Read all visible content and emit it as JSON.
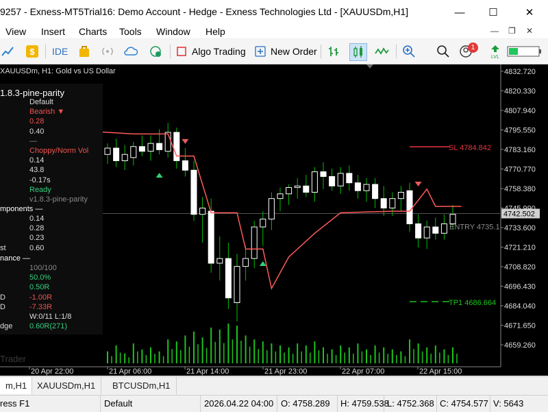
{
  "window": {
    "title": "9257 - Exness-MT5Trial16: Demo Account - Hedge - Exness Technologies Ltd - [XAUUSDm,H1]",
    "min_glyph": "—",
    "max_glyph": "☐",
    "close_glyph": "✕"
  },
  "menu": {
    "items": [
      "View",
      "Insert",
      "Charts",
      "Tools",
      "Window",
      "Help"
    ]
  },
  "toolbar": {
    "ide_label": "IDE",
    "algo_trading_label": "Algo Trading",
    "new_order_label": "New Order",
    "notification_count": "1",
    "icons": [
      "chart-icon",
      "dollar-icon",
      "ide-icon",
      "bag-icon",
      "signal-icon",
      "cloud-icon",
      "vps-icon",
      "algo-trading-icon",
      "new-order-icon",
      "bar-chart-icon",
      "candlestick-icon",
      "line-chart-icon",
      "zoom-in-icon",
      "search-icon",
      "user-icon",
      "level-icon",
      "battery-icon"
    ]
  },
  "chart": {
    "symbol_header": "XAUUSDm, H1:  Gold vs US Dollar",
    "watermark": "Trader",
    "colors": {
      "background": "#000000",
      "candle_up": "#ffffff",
      "candle_down": "#ffffff",
      "wick": "#00c000",
      "trail": "#ff5a5a",
      "sl": "#e8363f",
      "tp": "#1ec41e",
      "volume": "#1ec41e"
    },
    "price_axis": [
      "4832.720",
      "4820.330",
      "4807.940",
      "4795.550",
      "4783.160",
      "4770.770",
      "4758.380",
      "4745.990",
      "4733.600",
      "4721.210",
      "4708.820",
      "4696.430",
      "4684.040",
      "4671.650",
      "4659.260"
    ],
    "current_price_label": "4742.502",
    "sl_label": "SL 4784.842",
    "entry_label": "ENTRY 4735.1",
    "tp_label": "TP1 4686.664",
    "time_axis": [
      "20 Apr 22:00",
      "21 Apr 06:00",
      "21 Apr 14:00",
      "21 Apr 23:00",
      "22 Apr 07:00",
      "22 Apr 15:00"
    ]
  },
  "chart_data": {
    "type": "candlestick",
    "symbol": "XAUUSDm",
    "timeframe": "H1",
    "ylim": [
      4652,
      4838
    ],
    "candles": [
      {
        "o": 4780,
        "h": 4787,
        "l": 4774,
        "c": 4784
      },
      {
        "o": 4784,
        "h": 4790,
        "l": 4772,
        "c": 4776
      },
      {
        "o": 4776,
        "h": 4786,
        "l": 4770,
        "c": 4780
      },
      {
        "o": 4778,
        "h": 4788,
        "l": 4773,
        "c": 4785
      },
      {
        "o": 4785,
        "h": 4792,
        "l": 4779,
        "c": 4782
      },
      {
        "o": 4782,
        "h": 4792,
        "l": 4776,
        "c": 4787
      },
      {
        "o": 4787,
        "h": 4796,
        "l": 4780,
        "c": 4783
      },
      {
        "o": 4782,
        "h": 4800,
        "l": 4778,
        "c": 4794
      },
      {
        "o": 4794,
        "h": 4797,
        "l": 4771,
        "c": 4776
      },
      {
        "o": 4776,
        "h": 4784,
        "l": 4766,
        "c": 4770
      },
      {
        "o": 4770,
        "h": 4776,
        "l": 4738,
        "c": 4742
      },
      {
        "o": 4742,
        "h": 4753,
        "l": 4724,
        "c": 4746
      },
      {
        "o": 4744,
        "h": 4752,
        "l": 4705,
        "c": 4711
      },
      {
        "o": 4711,
        "h": 4728,
        "l": 4700,
        "c": 4714
      },
      {
        "o": 4714,
        "h": 4724,
        "l": 4682,
        "c": 4689
      },
      {
        "o": 4686,
        "h": 4717,
        "l": 4674,
        "c": 4709
      },
      {
        "o": 4709,
        "h": 4722,
        "l": 4700,
        "c": 4714
      },
      {
        "o": 4714,
        "h": 4738,
        "l": 4708,
        "c": 4734
      },
      {
        "o": 4734,
        "h": 4744,
        "l": 4722,
        "c": 4739
      },
      {
        "o": 4739,
        "h": 4756,
        "l": 4732,
        "c": 4752
      },
      {
        "o": 4752,
        "h": 4759,
        "l": 4744,
        "c": 4755
      },
      {
        "o": 4755,
        "h": 4761,
        "l": 4748,
        "c": 4759
      },
      {
        "o": 4759,
        "h": 4765,
        "l": 4752,
        "c": 4760
      },
      {
        "o": 4760,
        "h": 4767,
        "l": 4753,
        "c": 4756
      },
      {
        "o": 4756,
        "h": 4772,
        "l": 4750,
        "c": 4769
      },
      {
        "o": 4769,
        "h": 4775,
        "l": 4758,
        "c": 4766
      },
      {
        "o": 4766,
        "h": 4771,
        "l": 4757,
        "c": 4760
      },
      {
        "o": 4760,
        "h": 4772,
        "l": 4755,
        "c": 4768
      },
      {
        "o": 4768,
        "h": 4773,
        "l": 4757,
        "c": 4762
      },
      {
        "o": 4762,
        "h": 4767,
        "l": 4752,
        "c": 4757
      },
      {
        "o": 4757,
        "h": 4765,
        "l": 4750,
        "c": 4761
      },
      {
        "o": 4761,
        "h": 4765,
        "l": 4746,
        "c": 4752
      },
      {
        "o": 4752,
        "h": 4760,
        "l": 4741,
        "c": 4746
      },
      {
        "o": 4746,
        "h": 4756,
        "l": 4741,
        "c": 4752
      },
      {
        "o": 4752,
        "h": 4760,
        "l": 4744,
        "c": 4756
      },
      {
        "o": 4757,
        "h": 4762,
        "l": 4731,
        "c": 4736
      },
      {
        "o": 4736,
        "h": 4742,
        "l": 4721,
        "c": 4727
      },
      {
        "o": 4727,
        "h": 4738,
        "l": 4720,
        "c": 4734
      },
      {
        "o": 4734,
        "h": 4740,
        "l": 4726,
        "c": 4730
      },
      {
        "o": 4730,
        "h": 4742,
        "l": 4726,
        "c": 4736
      },
      {
        "o": 4736,
        "h": 4748,
        "l": 4733,
        "c": 4742
      }
    ],
    "trail_line": [
      {
        "i": -3,
        "v": 4795
      },
      {
        "i": 3,
        "v": 4793
      },
      {
        "i": 7,
        "v": 4793
      },
      {
        "i": 8,
        "v": 4779
      },
      {
        "i": 10,
        "v": 4779
      },
      {
        "i": 12,
        "v": 4743
      },
      {
        "i": 15,
        "v": 4743
      },
      {
        "i": 16,
        "v": 4720
      },
      {
        "i": 18,
        "v": 4720
      },
      {
        "i": 19,
        "v": 4695
      },
      {
        "i": 21,
        "v": 4715
      },
      {
        "i": 24,
        "v": 4730
      },
      {
        "i": 27,
        "v": 4743
      },
      {
        "i": 33,
        "v": 4744
      },
      {
        "i": 35,
        "v": 4744
      },
      {
        "i": 37,
        "v": 4758
      },
      {
        "i": 38,
        "v": 4747
      },
      {
        "i": 41,
        "v": 4747
      }
    ],
    "arrows": [
      {
        "i": 9,
        "dir": "down",
        "v": 4788,
        "color": "#e85b5b"
      },
      {
        "i": 6,
        "dir": "up",
        "v": 4767,
        "color": "#2fd27a"
      },
      {
        "i": 18,
        "dir": "up",
        "v": 4711,
        "color": "#2fd27a"
      },
      {
        "i": 36,
        "dir": "down",
        "v": 4761,
        "color": "#e85b5b"
      }
    ],
    "levels": [
      {
        "name": "SL",
        "value": 4784.842
      },
      {
        "name": "ENTRY",
        "value": 4735.1
      },
      {
        "name": "TP1",
        "value": 4686.664
      },
      {
        "name": "current",
        "value": 4742.502
      }
    ],
    "volume_relative": [
      0.3,
      0.45,
      0.25,
      0.5,
      0.35,
      0.4,
      0.3,
      0.6,
      0.55,
      0.7,
      0.8,
      0.65,
      0.9,
      0.85,
      1.0,
      0.95,
      0.7,
      0.6,
      0.55,
      0.5,
      0.45,
      0.4,
      0.5,
      0.45,
      0.55,
      0.4,
      0.35,
      0.45,
      0.4,
      0.5,
      0.35,
      0.45,
      0.4,
      0.35,
      0.3,
      0.6,
      0.5,
      0.4,
      0.45,
      0.35,
      0.4
    ],
    "x_tick_labels": [
      "20 Apr 22:00",
      "21 Apr 06:00",
      "21 Apr 14:00",
      "21 Apr 23:00",
      "22 Apr 07:00",
      "22 Apr 15:00"
    ],
    "y_tick_labels": [
      "4832.720",
      "4820.330",
      "4807.940",
      "4795.550",
      "4783.160",
      "4770.770",
      "4758.380",
      "4745.990",
      "4733.600",
      "4721.210",
      "4708.820",
      "4696.430",
      "4684.040",
      "4671.650",
      "4659.260"
    ]
  },
  "indicator_panel": {
    "title": "1.8.3-pine-parity",
    "rows_top": [
      {
        "label": "",
        "value": "Default",
        "color": "#dddddd"
      },
      {
        "label": "",
        "value": "Bearish ▼",
        "color": "#ef5350"
      },
      {
        "label": "",
        "value": "0.28",
        "color": "#ef5350"
      },
      {
        "label": "",
        "value": "0.40",
        "color": "#dddddd"
      },
      {
        "label": "",
        "value": "—",
        "color": "#888888"
      },
      {
        "label": "",
        "value": "Choppy/Norm Vol",
        "color": "#ef5350"
      },
      {
        "label": "",
        "value": "0.14",
        "color": "#dddddd"
      },
      {
        "label": "",
        "value": "43.8",
        "color": "#dddddd"
      },
      {
        "label": "",
        "value": "-0.17s",
        "color": "#dddddd"
      },
      {
        "label": "",
        "value": "Ready",
        "color": "#35d07f"
      },
      {
        "label": "",
        "value": "v1.8.3-pine-parity",
        "color": "#888888"
      }
    ],
    "section_components": "mponents —",
    "rows_comp": [
      {
        "label": "",
        "value": "0.14",
        "color": "#dddddd"
      },
      {
        "label": "",
        "value": "0.28",
        "color": "#dddddd"
      },
      {
        "label": "",
        "value": "0.23",
        "color": "#dddddd"
      },
      {
        "label": "st",
        "value": "0.60",
        "color": "#dddddd"
      }
    ],
    "section_performance": "nance —",
    "rows_perf": [
      {
        "label": "",
        "value": "100/100",
        "color": "#888888"
      },
      {
        "label": "",
        "value": "50.0%",
        "color": "#35d07f"
      },
      {
        "label": "",
        "value": "0.50R",
        "color": "#35d07f"
      },
      {
        "label": "D",
        "value": "-1.00R",
        "color": "#ef5350"
      },
      {
        "label": "D",
        "value": "-7.33R",
        "color": "#ef5350"
      },
      {
        "label": "",
        "value": "W:0/11 L:1/8",
        "color": "#dddddd"
      },
      {
        "label": "dge",
        "value": "0.60R(271)",
        "color": "#35d07f"
      }
    ]
  },
  "bottom_tabs": [
    {
      "label": "m,H1",
      "active": true
    },
    {
      "label": "XAUUSDm,H1",
      "active": false
    },
    {
      "label": "BTCUSDm,H1",
      "active": false
    }
  ],
  "status": {
    "help": "ress F1",
    "profile": "Default",
    "datetime": "2026.04.22 04:00",
    "open": "O: 4758.289",
    "high": "H: 4759.538",
    "low": "L: 4752.368",
    "close": "C: 4754.577",
    "volume": "V: 5643"
  }
}
